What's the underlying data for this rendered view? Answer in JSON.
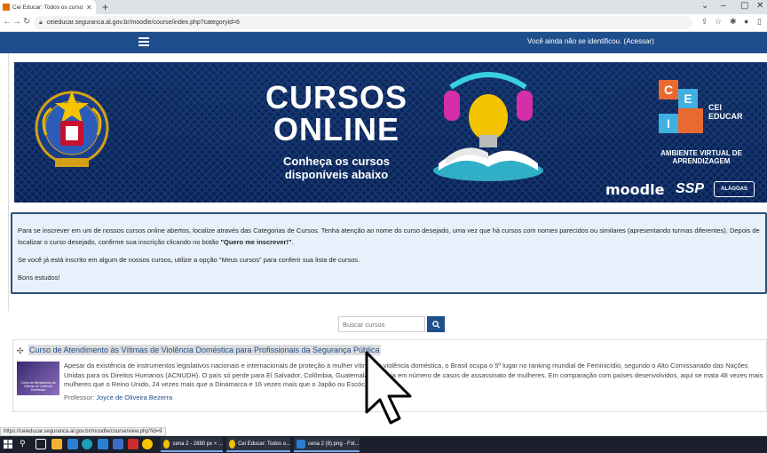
{
  "browser": {
    "tab_title": "Cei Educar: Todos os cursos",
    "url": "ceieducar.seguranca.al.gov.br/moodle/course/index.php?categoryid=6",
    "status_url": "https://ceieducar.seguranca.al.gov.br/moodle/course/view.php?id=9"
  },
  "navbar": {
    "login_text": "Você ainda não se identificou. (Acessar)"
  },
  "banner": {
    "headline_line1": "CURSOS",
    "headline_line2": "ONLINE",
    "sub_line1": "Conheça os cursos",
    "sub_line2": "disponíveis abaixo",
    "logo_letters": [
      "C",
      "E",
      "I"
    ],
    "logo_name_line1": "CEI",
    "logo_name_line2": "EDUCAR",
    "ava_line1": "AMBIENTE VIRTUAL DE",
    "ava_line2": "APRENDIZAGEM",
    "partner_moodle": "moodle",
    "partner_ssp": "SSP",
    "partner_alagoas": "ALAGOAS"
  },
  "info": {
    "paragraph1_pre": "Para se inscrever em um de nossos cursos online abertos, localize através das Categorias de Cursos. Tenha atenção ao nome do curso desejado, uma vez que há cursos com nomes parecidos ou similares (apresentando turmas diferentes). Depois de localizar o curso desejado, confirme sua inscrição clicando no botão ",
    "paragraph1_bold": "\"Quero me inscrever!\"",
    "paragraph1_post": ".",
    "paragraph2": "Se você já está inscrito em algum de nossos cursos, utilize a opção \"Meus cursos\" para conferir sua lista de cursos.",
    "paragraph3": "Bons estudos!"
  },
  "search": {
    "placeholder": "Buscar cursos"
  },
  "course": {
    "title": "Curso de Atendimento às Vítimas de Violência Doméstica para Profissionais da Segurança Pública",
    "image_caption": "Curso de Atendimento às Vítimas de Violência Doméstica",
    "summary": "Apesar da existência de instrumentos legislativos nacionais e internacionais de proteção à mulher vítima de violência doméstica, o Brasil ocupa o 5º lugar no ranking mundial de Feminicídio, segundo o Alto Comissariado das Nações Unidas para os Direitos Humanos (ACNUDH). O país só perde para El Salvador, Colômbia, Guatemala e Rússia em número de casos de assassinato de mulheres. Em comparação com países desenvolvidos, aqui se mata 48 vezes mais mulheres que o Reino Unido, 24 vezes mais que a Dinamarca e 16 vezes mais que o Japão ou Escócia.",
    "teacher_label": "Professor:",
    "teacher_name": "Joyce de Oliveira Bezerra"
  },
  "taskbar": {
    "tasks": [
      {
        "label": "cena 2 - 2880 px × ..."
      },
      {
        "label": "Cei Educar: Todos o..."
      },
      {
        "label": "cena 2 (8).png - Fot..."
      }
    ]
  }
}
